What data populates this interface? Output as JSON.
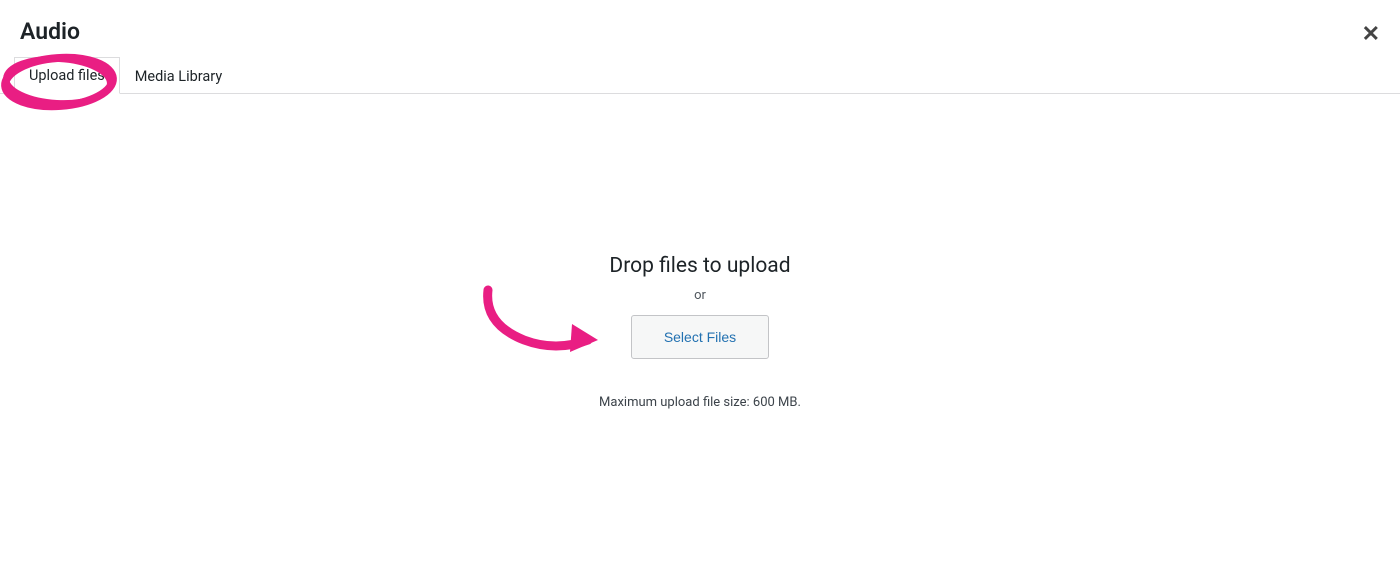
{
  "header": {
    "title": "Audio"
  },
  "tabs": {
    "upload_files": "Upload files",
    "media_library": "Media Library"
  },
  "upload": {
    "drop_heading": "Drop files to upload",
    "or": "or",
    "select_button": "Select Files",
    "max_size": "Maximum upload file size: 600 MB."
  },
  "annotation": {
    "color": "#e91e83"
  }
}
